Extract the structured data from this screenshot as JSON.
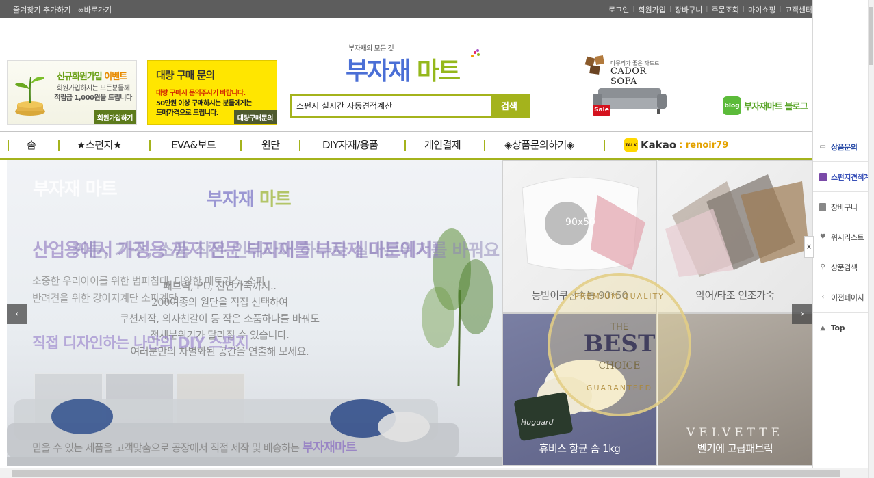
{
  "topbar": {
    "left": [
      "즐겨찾기 추가하기",
      "∞바로가기"
    ],
    "right": [
      "로그인",
      "회원가입",
      "장바구니",
      "주문조회",
      "마이쇼핑",
      "고객센터"
    ]
  },
  "banners": {
    "signup": {
      "title_a": "신규회원가입 ",
      "title_b": "이벤트",
      "line1": "회원가입하시는 모든분들께",
      "line2": "적립금 1,000원을 드립니다",
      "button": "회원가입하기"
    },
    "bulk": {
      "title": "대량 구매 문의",
      "line1": "대량 구매시 문의주시기 바랍니다.",
      "line2": "50만원 이상 구매하시는 분들에게는",
      "line3": "도매가격으로 드립니다.",
      "button": "대량구매문의"
    }
  },
  "logo": {
    "sub": "부자재의 모든 것",
    "part_a": "부자재 ",
    "part_b": "마트"
  },
  "search": {
    "value": "스펀지 실시간 자동견적계산",
    "button": "검색"
  },
  "cador": {
    "tagline": "마무리가 좋은 까도르",
    "brand": "CADOR SOFA",
    "sale": "Sale"
  },
  "blog": {
    "icon": "blog",
    "label": "부자재마트 블로그"
  },
  "nav": {
    "items": [
      "솜",
      "★스펀지★",
      "EVA&보드",
      "원단",
      "DIY자재/용품",
      "개인결제",
      "◈상품문의하기◈"
    ],
    "kakao": {
      "icon": "TALK",
      "name": "Kakao",
      "id": ": renoir79"
    }
  },
  "hero": {
    "logo1": "부자재 마트",
    "logo2_a": "부자재 ",
    "logo2_b": "마트",
    "headline1": "산업용에서 가정용 까지 전문 부자재를 부자재 마트에서!",
    "headline2": "커튼, 가구, 소품 작은 인테리어 하나로 실내분위기를 바꿔요",
    "para1": [
      "소중한 우리아이를 위한 범퍼침대, 다양한 매트가스, 소파",
      "반려견을 위한 강아지계단 소파계단"
    ],
    "para2": [
      "패브릭, PU, 천연가죽까지..",
      "200여종의 원단을 직접 선택하여",
      "쿠션제작, 의자천갈이 등 작은 소품하나를 바꿔도",
      "전체분위기가 달라질 수 있습니다.",
      "여러분만의 차별화된 공간을 연출해 보세요."
    ],
    "headline3": "직접 디자인하는 나만의 DIY 스펀지",
    "footer_a": "믿을 수 있는 제품을 고객맞춤으로 공장에서 직접 제작 및 배송하는 ",
    "footer_b": "부자재마트",
    "prev": "‹",
    "next": "›"
  },
  "tiles": [
    {
      "caption": "등받이쿠션속통 90*50",
      "badge": "90x50"
    },
    {
      "caption": "악어/타조 인조가죽"
    },
    {
      "caption": "휴비스 항균 솜 1kg",
      "brand": "Huguard"
    },
    {
      "caption": "벨기에 고급패브릭",
      "brand": "VELVETTE"
    }
  ],
  "seal": {
    "top": "PREMIUM QUALITY",
    "the": "THE",
    "best": "BEST",
    "choice": "CHOICE",
    "bottom": "GUARANTEED"
  },
  "quick": {
    "items": [
      "상품문의",
      "스펀지견적계산기",
      "장바구니",
      "위시리스트",
      "상품검색",
      "이전페이지",
      "Top"
    ],
    "close": "×"
  }
}
